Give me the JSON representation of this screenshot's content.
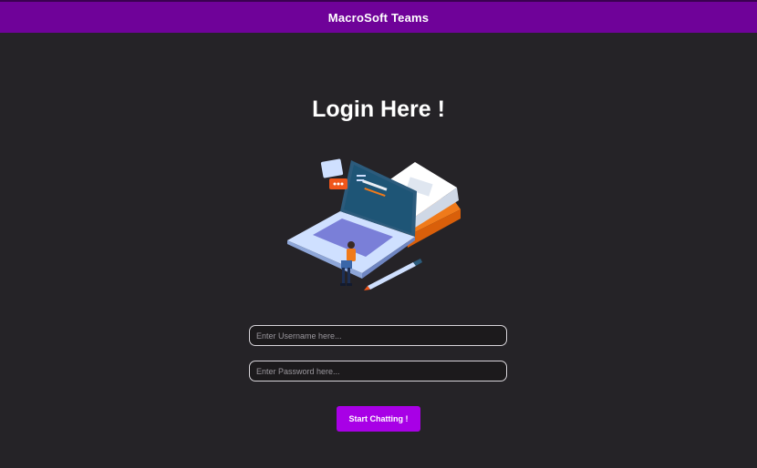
{
  "header": {
    "title": "MacroSoft Teams"
  },
  "login": {
    "heading": "Login Here !",
    "username_placeholder": "Enter Username here...",
    "password_placeholder": "Enter Password here...",
    "submit_label": "Start Chatting !"
  },
  "colors": {
    "header_bg": "#6f0299",
    "page_bg": "#252327",
    "button_bg": "#a800e6"
  }
}
